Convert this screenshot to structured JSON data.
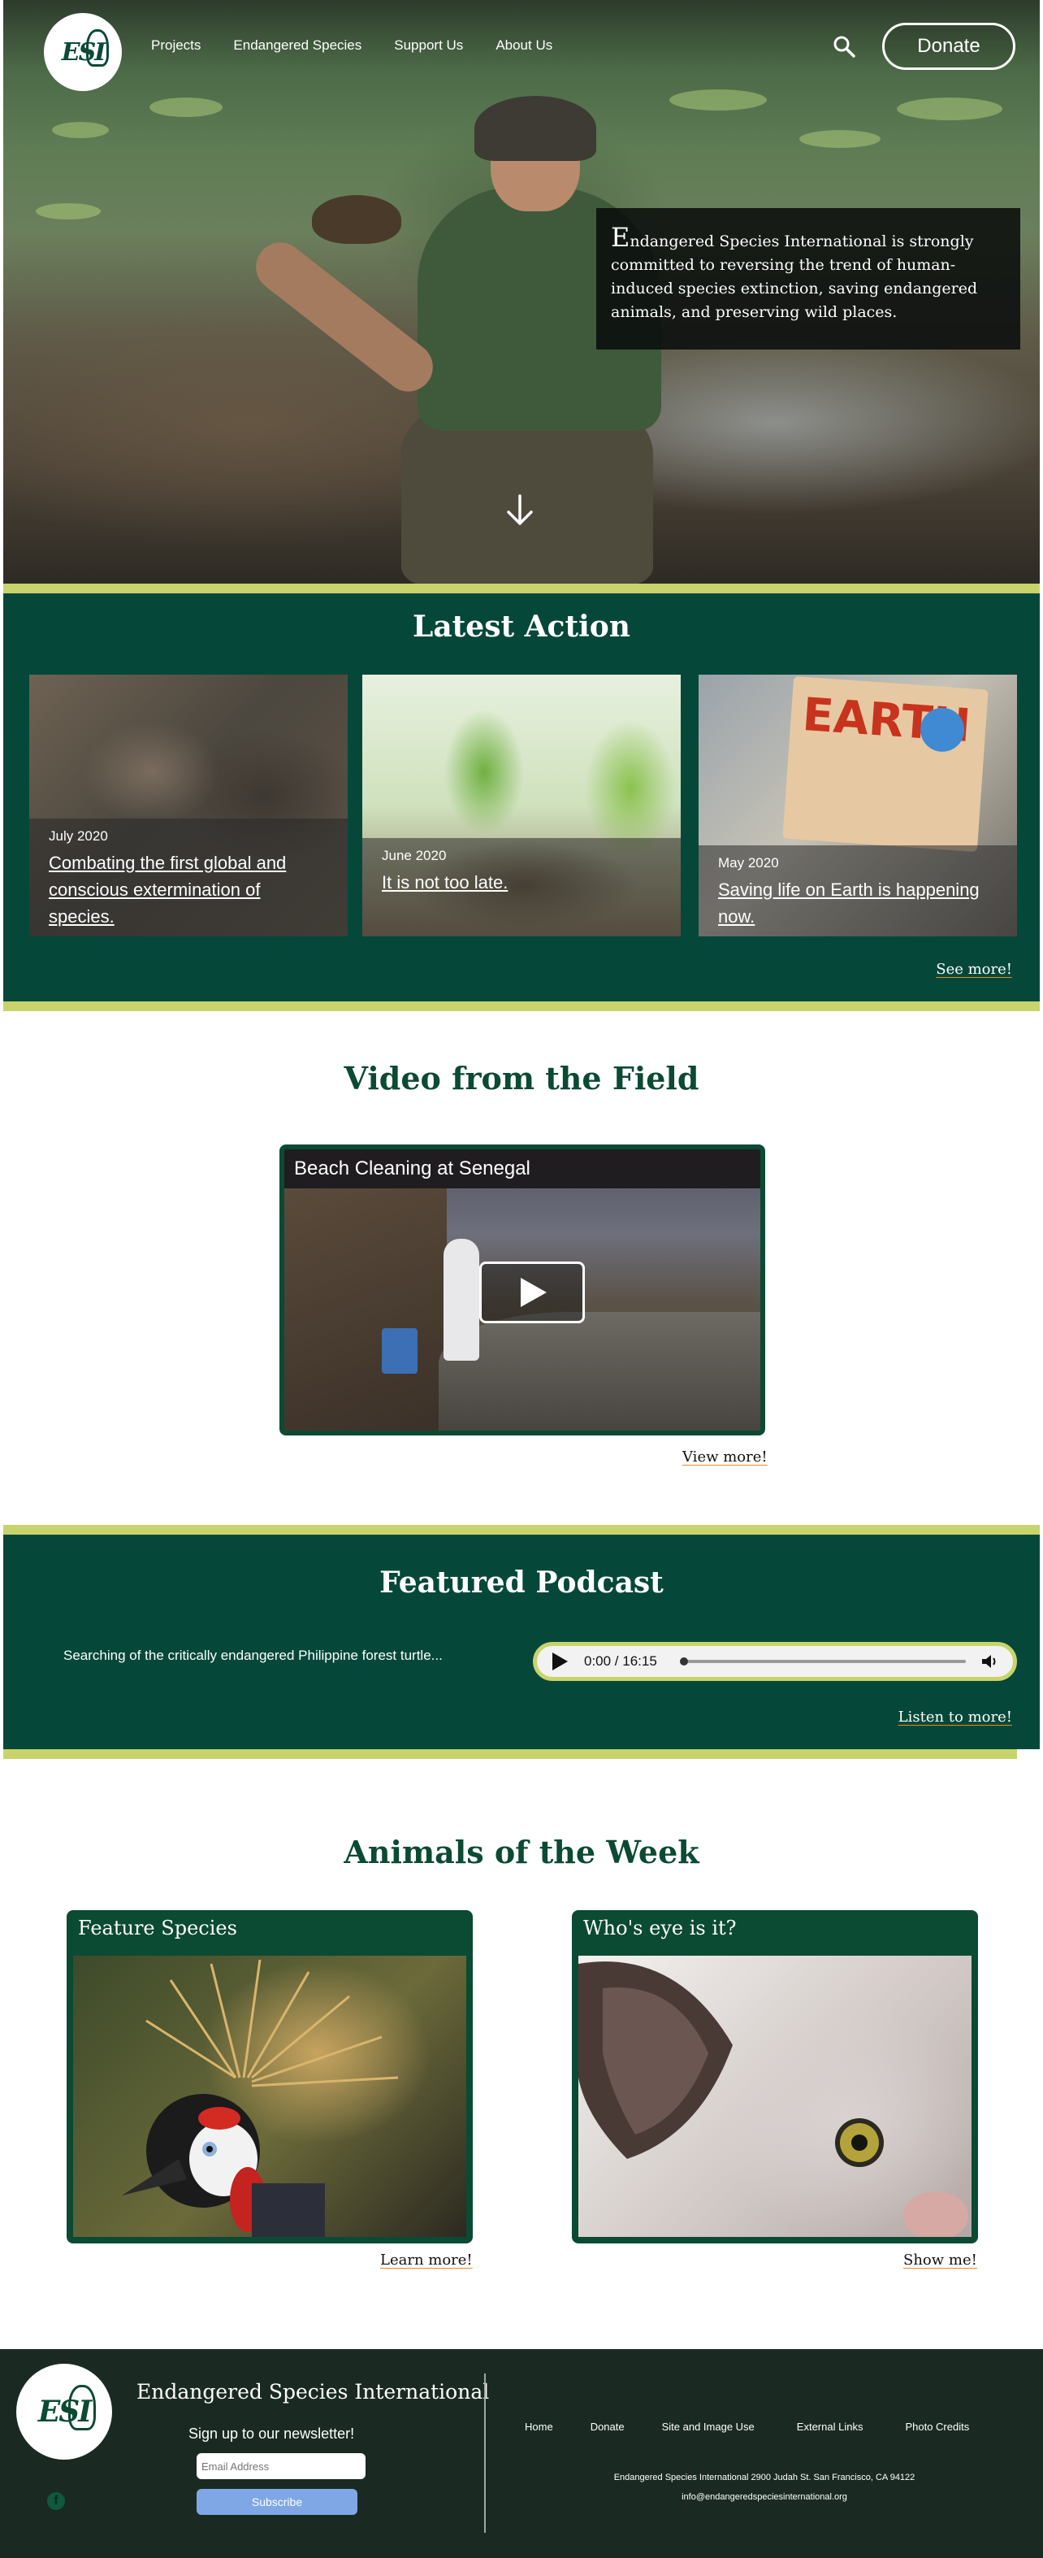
{
  "header": {
    "logo_text": "ESI",
    "nav": [
      "Projects",
      "Endangered Species",
      "Support Us",
      "About Us"
    ],
    "search_icon": "search-icon",
    "donate_label": "Donate"
  },
  "hero": {
    "mission_first_letter": "E",
    "mission_rest": "ndangered Species International is strongly committed to reversing the trend of human-induced species extinction, saving endangered animals, and preserving wild places.",
    "scroll_icon": "arrow-down-icon"
  },
  "latest_action": {
    "title": "Latest Action",
    "cards": [
      {
        "date": "July 2020",
        "title": "Combating the first global and conscious extermination of species."
      },
      {
        "date": "June 2020",
        "title": "It is not too late."
      },
      {
        "date": "May 2020",
        "title": "Saving life on Earth is happening now."
      }
    ],
    "sign_text": "EARTH",
    "see_more_label": "See more!"
  },
  "video": {
    "title": "Video from the Field",
    "video_title": "Beach Cleaning at Senegal",
    "play_icon": "play-icon",
    "view_more_label": "View more!"
  },
  "podcast": {
    "title": "Featured Podcast",
    "description": "Searching of the critically endangered Philippine forest turtle...",
    "time": "0:00 / 16:15",
    "progress": 0,
    "listen_more_label": "Listen to more!"
  },
  "animals": {
    "title": "Animals of the Week",
    "cards": [
      {
        "header": "Feature Species",
        "link": "Learn more!"
      },
      {
        "header": "Who's eye is it?",
        "link": "Show me!"
      }
    ]
  },
  "footer": {
    "logo_text": "ESI",
    "org_name": "Endangered Species International",
    "newsletter_label": "Sign up to our newsletter!",
    "email_placeholder": "Email Address",
    "subscribe_label": "Subscribe",
    "social_icon": "facebook-icon",
    "links": [
      "Home",
      "Donate",
      "Site and Image Use",
      "External Links",
      "Photo Credits"
    ],
    "address": "Endangered Species International 2900 Judah St. San Francisco, CA 94122",
    "email": "info@endangeredspeciesinternational.org"
  },
  "colors": {
    "brand_green": "#05483a",
    "lime_accent": "#c8d46b",
    "link_underline": "#e58a1c",
    "footer_bg": "#1a2a22"
  }
}
